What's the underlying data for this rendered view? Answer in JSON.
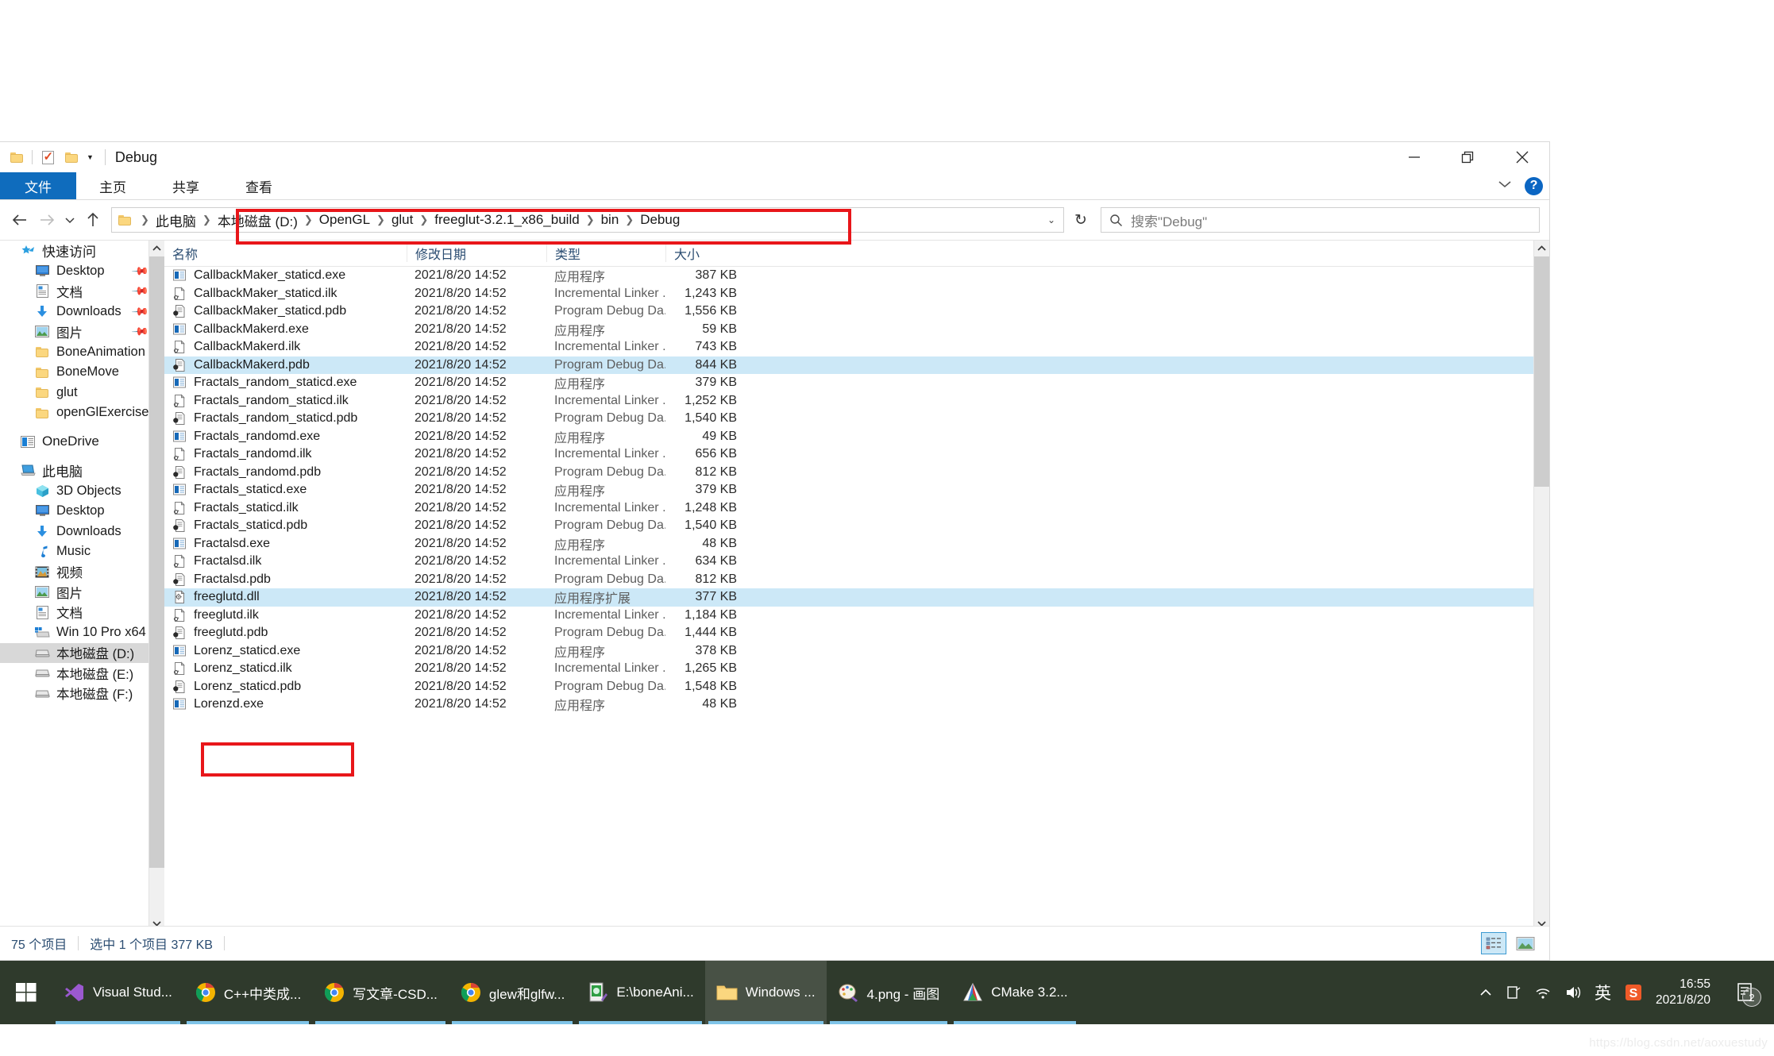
{
  "window": {
    "title": "Debug",
    "quick_access": [
      "folder-icon",
      "properties-icon",
      "new-folder-icon",
      "dropdown-caret"
    ],
    "minimize_label": "最小化",
    "maximize_label": "最大化",
    "close_label": "关闭"
  },
  "ribbon": {
    "tabs": [
      {
        "label": "文件",
        "active_file_menu": true
      },
      {
        "label": "主页",
        "active_file_menu": false
      },
      {
        "label": "共享",
        "active_file_menu": false
      },
      {
        "label": "查看",
        "active_file_menu": false
      }
    ],
    "expand_label": "展开功能区",
    "help_label": "?"
  },
  "address": {
    "back_label": "后退",
    "forward_label": "前进",
    "recent_label": "最近位置",
    "up_label": "上移一级",
    "breadcrumbs": [
      "此电脑",
      "本地磁盘 (D:)",
      "OpenGL",
      "glut",
      "freeglut-3.2.1_x86_build",
      "bin",
      "Debug"
    ],
    "refresh_label": "刷新",
    "search_placeholder": "搜索\"Debug\""
  },
  "sidebar": {
    "groups": [
      {
        "header": {
          "label": "快速访问",
          "icon": "star-pin-icon"
        },
        "items": [
          {
            "label": "Desktop",
            "icon": "desktop-icon",
            "pinned": true
          },
          {
            "label": "文档",
            "icon": "documents-icon",
            "pinned": true
          },
          {
            "label": "Downloads",
            "icon": "downloads-icon",
            "pinned": true
          },
          {
            "label": "图片",
            "icon": "pictures-icon",
            "pinned": true
          },
          {
            "label": "BoneAnimation",
            "icon": "folder-icon",
            "pinned": false
          },
          {
            "label": "BoneMove",
            "icon": "folder-icon",
            "pinned": false
          },
          {
            "label": "glut",
            "icon": "folder-icon",
            "pinned": false
          },
          {
            "label": "openGlExercise",
            "icon": "folder-icon",
            "pinned": false
          }
        ]
      },
      {
        "header": {
          "label": "OneDrive",
          "icon": "onedrive-icon"
        },
        "items": []
      },
      {
        "header": {
          "label": "此电脑",
          "icon": "thispc-icon"
        },
        "items": [
          {
            "label": "3D Objects",
            "icon": "3dobjects-icon",
            "selected": false
          },
          {
            "label": "Desktop",
            "icon": "desktop-icon",
            "selected": false
          },
          {
            "label": "Downloads",
            "icon": "downloads-icon",
            "selected": false
          },
          {
            "label": "Music",
            "icon": "music-icon",
            "selected": false
          },
          {
            "label": "视频",
            "icon": "videos-icon",
            "selected": false
          },
          {
            "label": "图片",
            "icon": "pictures-icon",
            "selected": false
          },
          {
            "label": "文档",
            "icon": "documents-icon",
            "selected": false
          },
          {
            "label": "Win 10 Pro x64",
            "icon": "windows-drive-icon",
            "selected": false
          },
          {
            "label": "本地磁盘 (D:)",
            "icon": "drive-icon",
            "selected": true
          },
          {
            "label": "本地磁盘 (E:)",
            "icon": "drive-icon",
            "selected": false
          },
          {
            "label": "本地磁盘 (F:)",
            "icon": "drive-icon",
            "selected": false
          }
        ]
      }
    ]
  },
  "filelist": {
    "columns": [
      {
        "key": "name",
        "label": "名称"
      },
      {
        "key": "date",
        "label": "修改日期"
      },
      {
        "key": "type",
        "label": "类型"
      },
      {
        "key": "size",
        "label": "大小"
      }
    ],
    "rows": [
      {
        "name": "CallbackMaker_staticd.exe",
        "date": "2021/8/20 14:52",
        "type": "应用程序",
        "size": "387 KB",
        "icon": "exe-icon",
        "selected": false
      },
      {
        "name": "CallbackMaker_staticd.ilk",
        "date": "2021/8/20 14:52",
        "type": "Incremental Linker ...",
        "size": "1,243 KB",
        "icon": "ilk-icon",
        "selected": false
      },
      {
        "name": "CallbackMaker_staticd.pdb",
        "date": "2021/8/20 14:52",
        "type": "Program Debug Da...",
        "size": "1,556 KB",
        "icon": "pdb-icon",
        "selected": false
      },
      {
        "name": "CallbackMakerd.exe",
        "date": "2021/8/20 14:52",
        "type": "应用程序",
        "size": "59 KB",
        "icon": "exe-icon",
        "selected": false
      },
      {
        "name": "CallbackMakerd.ilk",
        "date": "2021/8/20 14:52",
        "type": "Incremental Linker ...",
        "size": "743 KB",
        "icon": "ilk-icon",
        "selected": false
      },
      {
        "name": "CallbackMakerd.pdb",
        "date": "2021/8/20 14:52",
        "type": "Program Debug Da...",
        "size": "844 KB",
        "icon": "pdb-icon",
        "selected": true
      },
      {
        "name": "Fractals_random_staticd.exe",
        "date": "2021/8/20 14:52",
        "type": "应用程序",
        "size": "379 KB",
        "icon": "exe-icon",
        "selected": false
      },
      {
        "name": "Fractals_random_staticd.ilk",
        "date": "2021/8/20 14:52",
        "type": "Incremental Linker ...",
        "size": "1,252 KB",
        "icon": "ilk-icon",
        "selected": false
      },
      {
        "name": "Fractals_random_staticd.pdb",
        "date": "2021/8/20 14:52",
        "type": "Program Debug Da...",
        "size": "1,540 KB",
        "icon": "pdb-icon",
        "selected": false
      },
      {
        "name": "Fractals_randomd.exe",
        "date": "2021/8/20 14:52",
        "type": "应用程序",
        "size": "49 KB",
        "icon": "exe-icon",
        "selected": false
      },
      {
        "name": "Fractals_randomd.ilk",
        "date": "2021/8/20 14:52",
        "type": "Incremental Linker ...",
        "size": "656 KB",
        "icon": "ilk-icon",
        "selected": false
      },
      {
        "name": "Fractals_randomd.pdb",
        "date": "2021/8/20 14:52",
        "type": "Program Debug Da...",
        "size": "812 KB",
        "icon": "pdb-icon",
        "selected": false
      },
      {
        "name": "Fractals_staticd.exe",
        "date": "2021/8/20 14:52",
        "type": "应用程序",
        "size": "379 KB",
        "icon": "exe-icon",
        "selected": false
      },
      {
        "name": "Fractals_staticd.ilk",
        "date": "2021/8/20 14:52",
        "type": "Incremental Linker ...",
        "size": "1,248 KB",
        "icon": "ilk-icon",
        "selected": false
      },
      {
        "name": "Fractals_staticd.pdb",
        "date": "2021/8/20 14:52",
        "type": "Program Debug Da...",
        "size": "1,540 KB",
        "icon": "pdb-icon",
        "selected": false
      },
      {
        "name": "Fractalsd.exe",
        "date": "2021/8/20 14:52",
        "type": "应用程序",
        "size": "48 KB",
        "icon": "exe-icon",
        "selected": false
      },
      {
        "name": "Fractalsd.ilk",
        "date": "2021/8/20 14:52",
        "type": "Incremental Linker ...",
        "size": "634 KB",
        "icon": "ilk-icon",
        "selected": false
      },
      {
        "name": "Fractalsd.pdb",
        "date": "2021/8/20 14:52",
        "type": "Program Debug Da...",
        "size": "812 KB",
        "icon": "pdb-icon",
        "selected": false
      },
      {
        "name": "freeglutd.dll",
        "date": "2021/8/20 14:52",
        "type": "应用程序扩展",
        "size": "377 KB",
        "icon": "dll-icon",
        "selected": true
      },
      {
        "name": "freeglutd.ilk",
        "date": "2021/8/20 14:52",
        "type": "Incremental Linker ...",
        "size": "1,184 KB",
        "icon": "ilk-icon",
        "selected": false
      },
      {
        "name": "freeglutd.pdb",
        "date": "2021/8/20 14:52",
        "type": "Program Debug Da...",
        "size": "1,444 KB",
        "icon": "pdb-icon",
        "selected": false
      },
      {
        "name": "Lorenz_staticd.exe",
        "date": "2021/8/20 14:52",
        "type": "应用程序",
        "size": "378 KB",
        "icon": "exe-icon",
        "selected": false
      },
      {
        "name": "Lorenz_staticd.ilk",
        "date": "2021/8/20 14:52",
        "type": "Incremental Linker ...",
        "size": "1,265 KB",
        "icon": "ilk-icon",
        "selected": false
      },
      {
        "name": "Lorenz_staticd.pdb",
        "date": "2021/8/20 14:52",
        "type": "Program Debug Da...",
        "size": "1,548 KB",
        "icon": "pdb-icon",
        "selected": false
      },
      {
        "name": "Lorenzd.exe",
        "date": "2021/8/20 14:52",
        "type": "应用程序",
        "size": "48 KB",
        "icon": "exe-icon",
        "selected": false
      }
    ]
  },
  "statusbar": {
    "item_count": "75 个项目",
    "selection": "选中 1 个项目  377 KB",
    "view_details_label": "详细信息",
    "view_large_label": "大图标"
  },
  "taskbar": {
    "start_label": "开始",
    "items": [
      {
        "label": "Visual Stud...",
        "icon": "visualstudio-icon",
        "active": false
      },
      {
        "label": "C++中类成...",
        "icon": "chrome-icon",
        "active": false
      },
      {
        "label": "写文章-CSD...",
        "icon": "chrome-icon",
        "active": false
      },
      {
        "label": "glew和glfw...",
        "icon": "chrome-icon",
        "active": false
      },
      {
        "label": "E:\\boneAni...",
        "icon": "notepadpp-icon",
        "active": false
      },
      {
        "label": "Windows ...",
        "icon": "folder-icon",
        "active": true
      },
      {
        "label": "4.png - 画图",
        "icon": "paint-icon",
        "active": false
      },
      {
        "label": "CMake 3.2...",
        "icon": "cmake-icon",
        "active": false
      }
    ],
    "tray": [
      {
        "icon": "chevron-up-icon",
        "label": "显示隐藏的图标"
      },
      {
        "icon": "tray-device-icon",
        "label": "设备"
      },
      {
        "icon": "wifi-icon",
        "label": "网络"
      },
      {
        "icon": "volume-icon",
        "label": "音量"
      },
      {
        "icon": "ime-icon",
        "label": "英"
      },
      {
        "icon": "sogou-icon",
        "label": "S"
      }
    ],
    "clock_time": "16:55",
    "clock_date": "2021/8/20",
    "notification_count": "2"
  },
  "watermark": {
    "text": "https://blog.csdn.net/aoxuestudy"
  },
  "colors": {
    "accent_blue": "#0f6cbd",
    "selection_blue": "#cce8f7",
    "annotation_red": "#e8161a",
    "taskbar_bg": "#2f3a2c",
    "sidebar_selected": "#d8d8d8"
  }
}
